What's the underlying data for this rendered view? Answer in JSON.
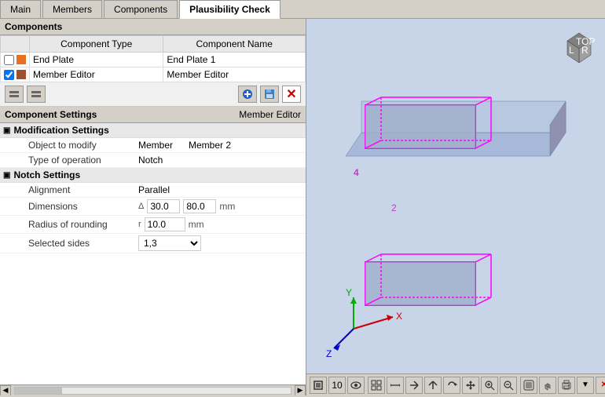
{
  "tabs": [
    {
      "label": "Main",
      "active": false
    },
    {
      "label": "Members",
      "active": false
    },
    {
      "label": "Components",
      "active": false
    },
    {
      "label": "Plausibility Check",
      "active": true
    }
  ],
  "components_section": {
    "title": "Components",
    "table": {
      "headers": [
        "Component Type",
        "Component Name"
      ],
      "rows": [
        {
          "checked": false,
          "color": "#e87020",
          "type": "End Plate",
          "name": "End Plate 1"
        },
        {
          "checked": true,
          "color": "#a05030",
          "type": "Member Editor",
          "name": "Member Editor"
        }
      ]
    }
  },
  "toolbar": {
    "buttons": [
      "move_left",
      "move_right",
      "add",
      "save",
      "delete"
    ]
  },
  "component_settings": {
    "title": "Component Settings",
    "subtitle": "Member Editor",
    "modification_settings": {
      "label": "Modification Settings",
      "fields": [
        {
          "name": "Object to modify",
          "value": "Member",
          "value2": "Member 2"
        },
        {
          "name": "Type of operation",
          "value": "Notch",
          "value2": ""
        }
      ]
    },
    "notch_settings": {
      "label": "Notch Settings",
      "fields": [
        {
          "name": "Alignment",
          "symbol": "",
          "value": "Parallel",
          "unit": ""
        },
        {
          "name": "Dimensions",
          "symbol": "Δ",
          "value1": "30.0",
          "value2": "80.0",
          "unit": "mm"
        },
        {
          "name": "Radius of rounding",
          "symbol": "r",
          "value": "10.0",
          "unit": "mm"
        },
        {
          "name": "Selected sides",
          "symbol": "",
          "value": "1,3",
          "unit": "",
          "type": "select"
        }
      ]
    }
  },
  "view_toolbar": {
    "zoom_value": "10",
    "buttons": [
      "home",
      "zoom",
      "eye",
      "fit-all",
      "fit-width",
      "x-view",
      "z-view",
      "rotate",
      "pan",
      "zoom-in",
      "zoom-out",
      "settings",
      "close",
      "maximize"
    ]
  }
}
